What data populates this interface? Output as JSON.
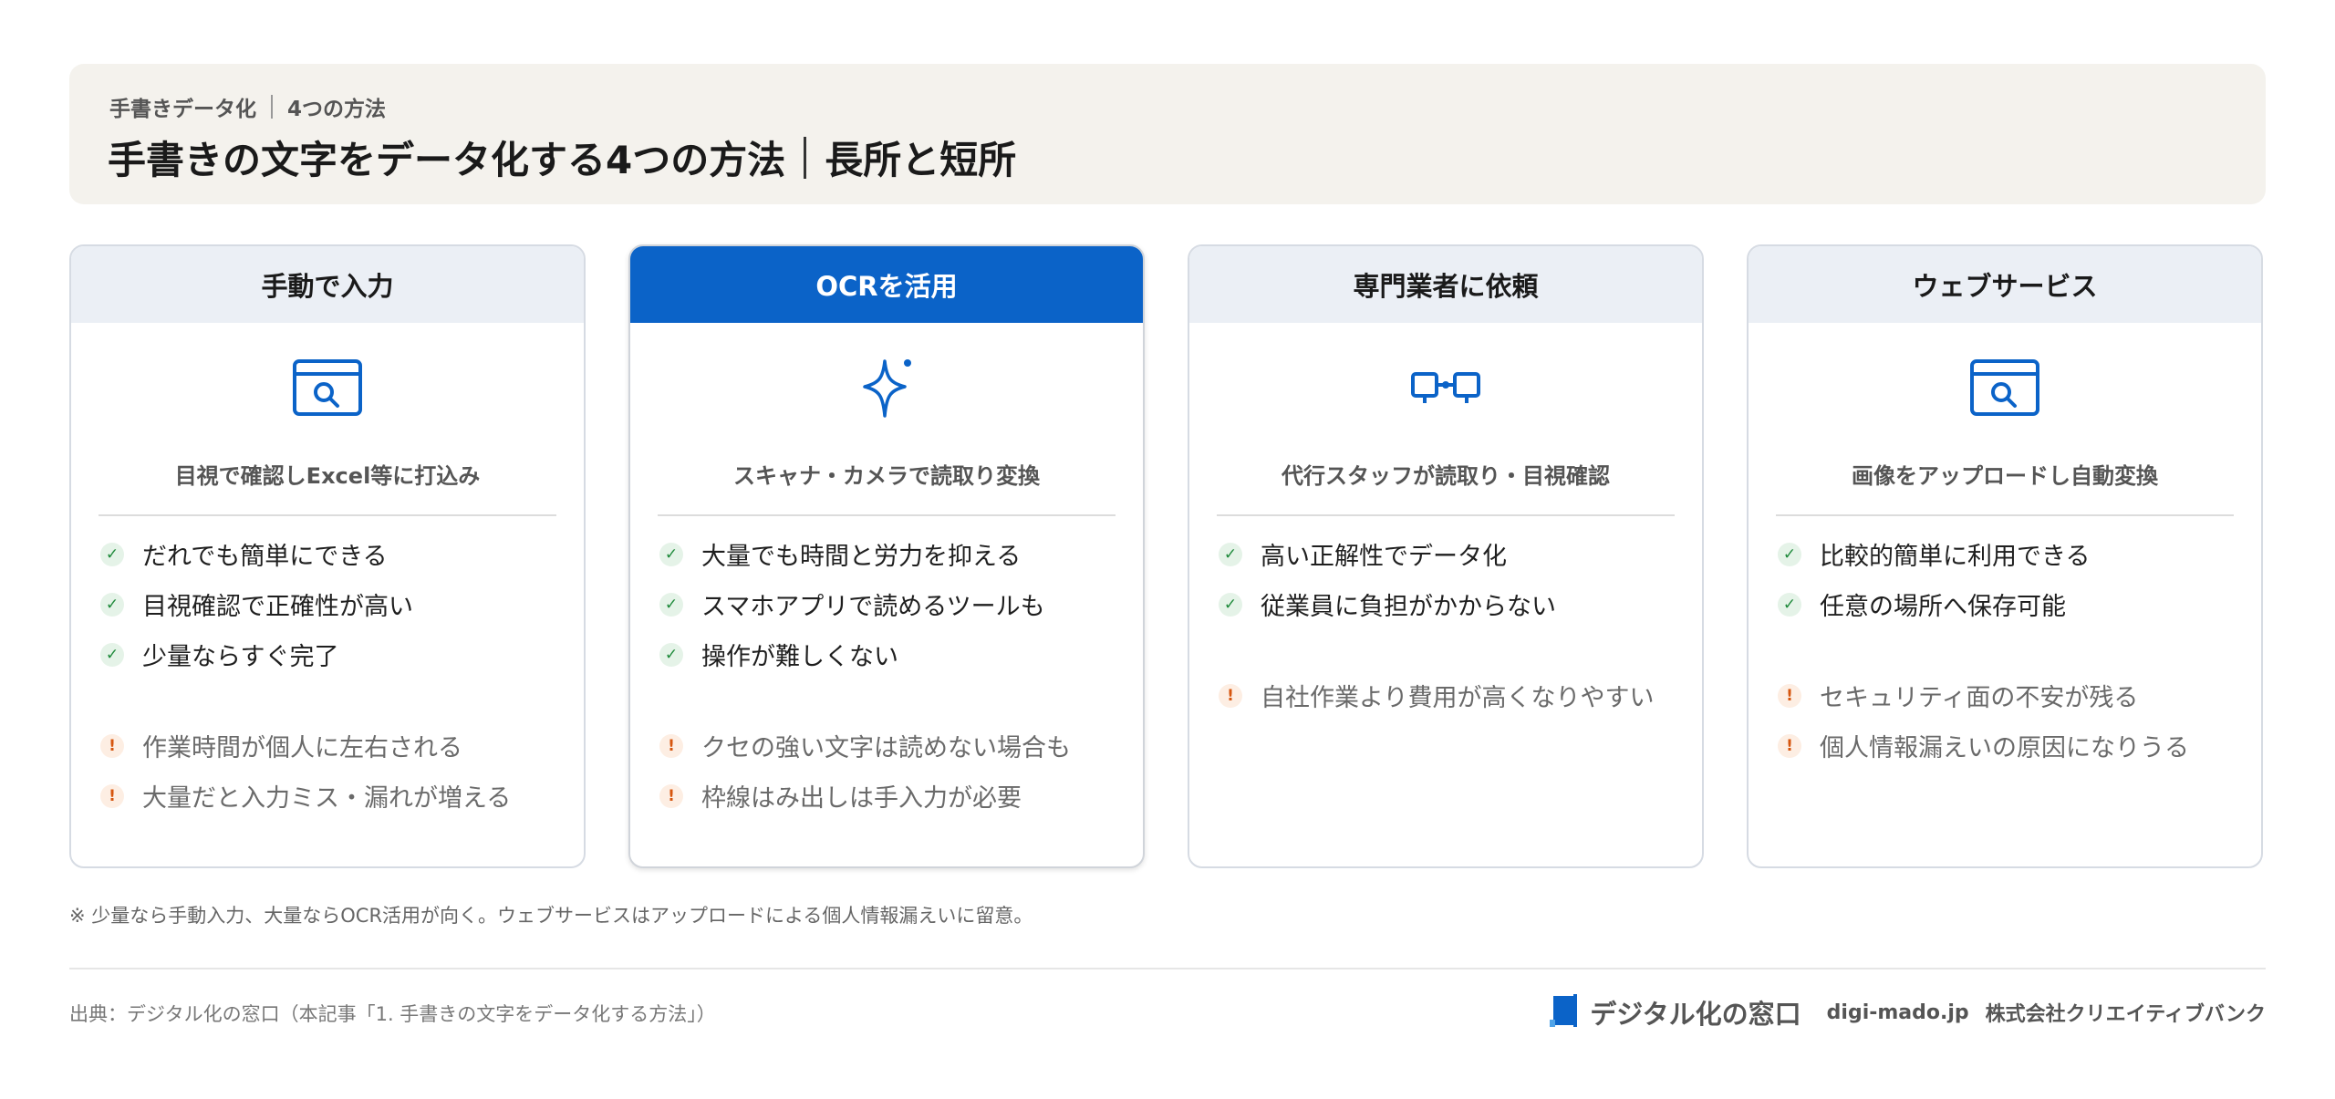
{
  "header": {
    "breadcrumb_1": "手書きデータ化",
    "breadcrumb_2": "4つの方法",
    "title_main": "手書きの文字をデータ化する4つの方法",
    "title_sub": "長所と短所"
  },
  "cards": [
    {
      "title": "手動で入力",
      "icon": "browser-search-icon",
      "subtitle": "目視で確認しExcel等に打込み",
      "pros": [
        "だれでも簡単にできる",
        "目視確認で正確性が高い",
        "少量ならすぐ完了"
      ],
      "cons": [
        "作業時間が個人に左右される",
        "大量だと入力ミス・漏れが増える"
      ]
    },
    {
      "title": "OCRを活用",
      "icon": "sparkle-icon",
      "subtitle": "スキャナ・カメラで読取り変換",
      "pros": [
        "大量でも時間と労力を抑える",
        "スマホアプリで読めるツールも",
        "操作が難しくない"
      ],
      "cons": [
        "クセの強い文字は読めない場合も",
        "枠線はみ出しは手入力が必要"
      ]
    },
    {
      "title": "専門業者に依頼",
      "icon": "linked-boxes-icon",
      "subtitle": "代行スタッフが読取り・目視確認",
      "pros": [
        "高い正解性でデータ化",
        "従業員に負担がかからない"
      ],
      "cons": [
        "自社作業より費用が高くなりやすい"
      ]
    },
    {
      "title": "ウェブサービス",
      "icon": "browser-search-icon",
      "subtitle": "画像をアップロードし自動変換",
      "pros": [
        "比較的簡単に利用できる",
        "任意の場所へ保存可能"
      ],
      "cons": [
        "セキュリティ面の不安が残る",
        "個人情報漏えいの原因になりうる"
      ]
    }
  ],
  "note": "※ 少量なら手動入力、大量ならOCR活用が向く。ウェブサービスはアップロードによる個人情報漏えいに留意。",
  "footer": {
    "source": "出典：デジタル化の窓口（本記事「1. 手書きの文字をデータ化する方法」）",
    "brand_name": "デジタル化の窓口",
    "domain": "digi-mado.jp",
    "company": "株式会社クリエイティブバンク"
  },
  "colors": {
    "accent": "#0b63c8",
    "header_bg": "#f4f2ed",
    "pro": "#1f8a3b",
    "con": "#d6560e"
  }
}
